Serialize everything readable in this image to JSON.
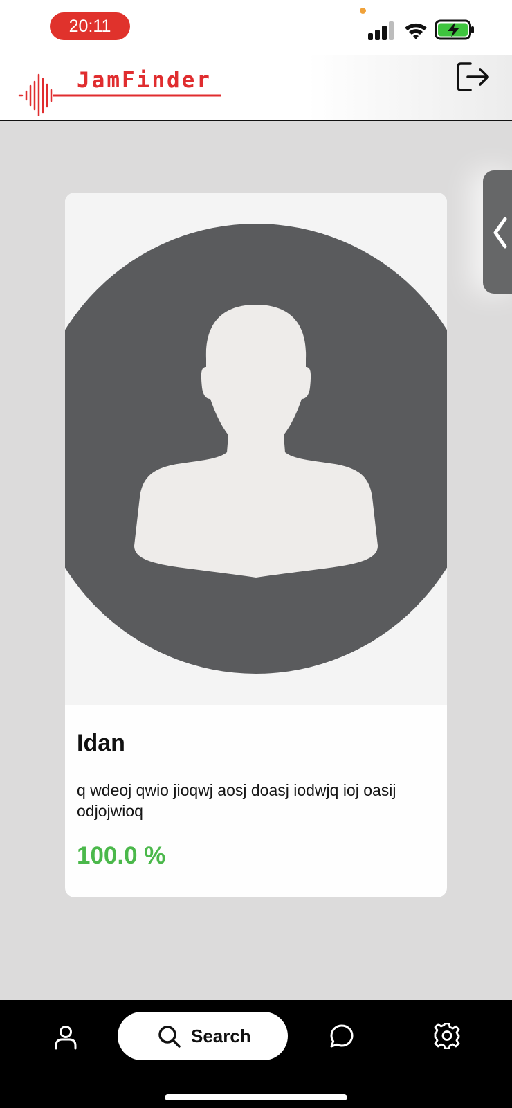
{
  "status_bar": {
    "time": "20:11"
  },
  "header": {
    "app_title": "JamFinder"
  },
  "card": {
    "name": "Idan",
    "bio": "q wdeoj qwio jioqwj aosj doasj iodwjq ioj oasij odjojwioq",
    "match": "100.0 %"
  },
  "nav": {
    "search_label": "Search"
  },
  "colors": {
    "brand_red": "#e02d2f",
    "match_green": "#4bb84b",
    "avatar_bg": "#5a5b5d",
    "avatar_figure": "#eeecea"
  },
  "icons": {
    "logout": "logout-icon",
    "side_tab": "chevron-left-icon",
    "profile": "user-icon",
    "search": "search-icon",
    "chat": "chat-bubble-icon",
    "settings": "gear-icon"
  }
}
